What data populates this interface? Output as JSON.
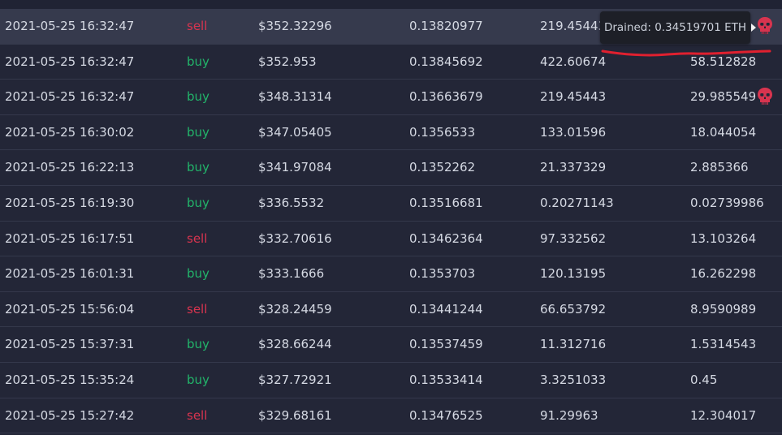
{
  "trades": [
    {
      "time": "2021-05-25 16:32:47",
      "side": "sell",
      "price": "$352.32296",
      "eth_price": "0.13820977",
      "amount": "219.45443",
      "value": "",
      "mark": "skull-icon"
    },
    {
      "time": "2021-05-25 16:32:47",
      "side": "buy",
      "price": "$352.953",
      "eth_price": "0.13845692",
      "amount": "422.60674",
      "value": "58.512828",
      "mark": ""
    },
    {
      "time": "2021-05-25 16:32:47",
      "side": "buy",
      "price": "$348.31314",
      "eth_price": "0.13663679",
      "amount": "219.45443",
      "value": "29.985549",
      "mark": "skull-icon"
    },
    {
      "time": "2021-05-25 16:30:02",
      "side": "buy",
      "price": "$347.05405",
      "eth_price": "0.1356533",
      "amount": "133.01596",
      "value": "18.044054",
      "mark": ""
    },
    {
      "time": "2021-05-25 16:22:13",
      "side": "buy",
      "price": "$341.97084",
      "eth_price": "0.1352262",
      "amount": "21.337329",
      "value": "2.885366",
      "mark": ""
    },
    {
      "time": "2021-05-25 16:19:30",
      "side": "buy",
      "price": "$336.5532",
      "eth_price": "0.13516681",
      "amount": "0.20271143",
      "value": "0.02739986",
      "mark": ""
    },
    {
      "time": "2021-05-25 16:17:51",
      "side": "sell",
      "price": "$332.70616",
      "eth_price": "0.13462364",
      "amount": "97.332562",
      "value": "13.103264",
      "mark": ""
    },
    {
      "time": "2021-05-25 16:01:31",
      "side": "buy",
      "price": "$333.1666",
      "eth_price": "0.1353703",
      "amount": "120.13195",
      "value": "16.262298",
      "mark": ""
    },
    {
      "time": "2021-05-25 15:56:04",
      "side": "sell",
      "price": "$328.24459",
      "eth_price": "0.13441244",
      "amount": "66.653792",
      "value": "8.9590989",
      "mark": ""
    },
    {
      "time": "2021-05-25 15:37:31",
      "side": "buy",
      "price": "$328.66244",
      "eth_price": "0.13537459",
      "amount": "11.312716",
      "value": "1.5314543",
      "mark": ""
    },
    {
      "time": "2021-05-25 15:35:24",
      "side": "buy",
      "price": "$327.72921",
      "eth_price": "0.13533414",
      "amount": "3.3251033",
      "value": "0.45",
      "mark": ""
    },
    {
      "time": "2021-05-25 15:27:42",
      "side": "sell",
      "price": "$329.68161",
      "eth_price": "0.13476525",
      "amount": "91.29963",
      "value": "12.304017",
      "mark": ""
    }
  ],
  "tooltip": {
    "text": "Drained: 0.34519701 ETH"
  },
  "colors": {
    "sell": "#d8344f",
    "buy": "#22b46a",
    "mark": "#d8344f",
    "annotation": "#e0202f"
  }
}
